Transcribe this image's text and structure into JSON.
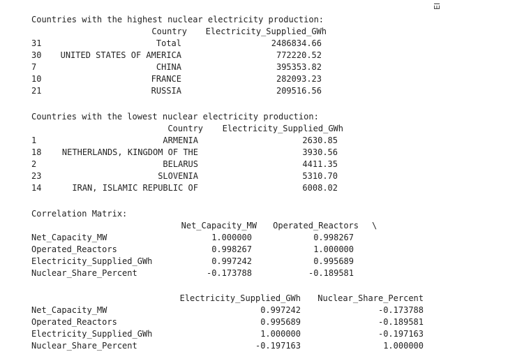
{
  "side_tab": {
    "label": "El"
  },
  "high": {
    "title": "Countries with the highest nuclear electricity production:",
    "headers": [
      "Country",
      "Electricity_Supplied_GWh"
    ],
    "rows": [
      {
        "idx": "31",
        "country": "Total",
        "value": "2486834.66"
      },
      {
        "idx": "30",
        "country": "UNITED STATES OF AMERICA",
        "value": "772220.52"
      },
      {
        "idx": "7",
        "country": "CHINA",
        "value": "395353.82"
      },
      {
        "idx": "10",
        "country": "FRANCE",
        "value": "282093.23"
      },
      {
        "idx": "21",
        "country": "RUSSIA",
        "value": "209516.56"
      }
    ]
  },
  "low": {
    "title": "Countries with the lowest nuclear electricity production:",
    "headers": [
      "Country",
      "Electricity_Supplied_GWh"
    ],
    "rows": [
      {
        "idx": "1",
        "country": "ARMENIA",
        "value": "2630.85"
      },
      {
        "idx": "18",
        "country": "NETHERLANDS, KINGDOM OF THE",
        "value": "3930.56"
      },
      {
        "idx": "2",
        "country": "BELARUS",
        "value": "4411.35"
      },
      {
        "idx": "23",
        "country": "SLOVENIA",
        "value": "5310.70"
      },
      {
        "idx": "14",
        "country": "IRAN, ISLAMIC REPUBLIC OF",
        "value": "6008.02"
      }
    ]
  },
  "corr": {
    "title": "Correlation Matrix:",
    "part1": {
      "headers": [
        "Net_Capacity_MW",
        "Operated_Reactors",
        "\\"
      ],
      "rows": [
        {
          "label": "Net_Capacity_MW",
          "v1": "1.000000",
          "v2": "0.998267"
        },
        {
          "label": "Operated_Reactors",
          "v1": "0.998267",
          "v2": "1.000000"
        },
        {
          "label": "Electricity_Supplied_GWh",
          "v1": "0.997242",
          "v2": "0.995689"
        },
        {
          "label": "Nuclear_Share_Percent",
          "v1": "-0.173788",
          "v2": "-0.189581"
        }
      ]
    },
    "part2": {
      "headers": [
        "Electricity_Supplied_GWh",
        "Nuclear_Share_Percent"
      ],
      "rows": [
        {
          "label": "Net_Capacity_MW",
          "v1": "0.997242",
          "v2": "-0.173788"
        },
        {
          "label": "Operated_Reactors",
          "v1": "0.995689",
          "v2": "-0.189581"
        },
        {
          "label": "Electricity_Supplied_GWh",
          "v1": "1.000000",
          "v2": "-0.197163"
        },
        {
          "label": "Nuclear_Share_Percent",
          "v1": "-0.197163",
          "v2": "1.000000"
        }
      ]
    }
  }
}
